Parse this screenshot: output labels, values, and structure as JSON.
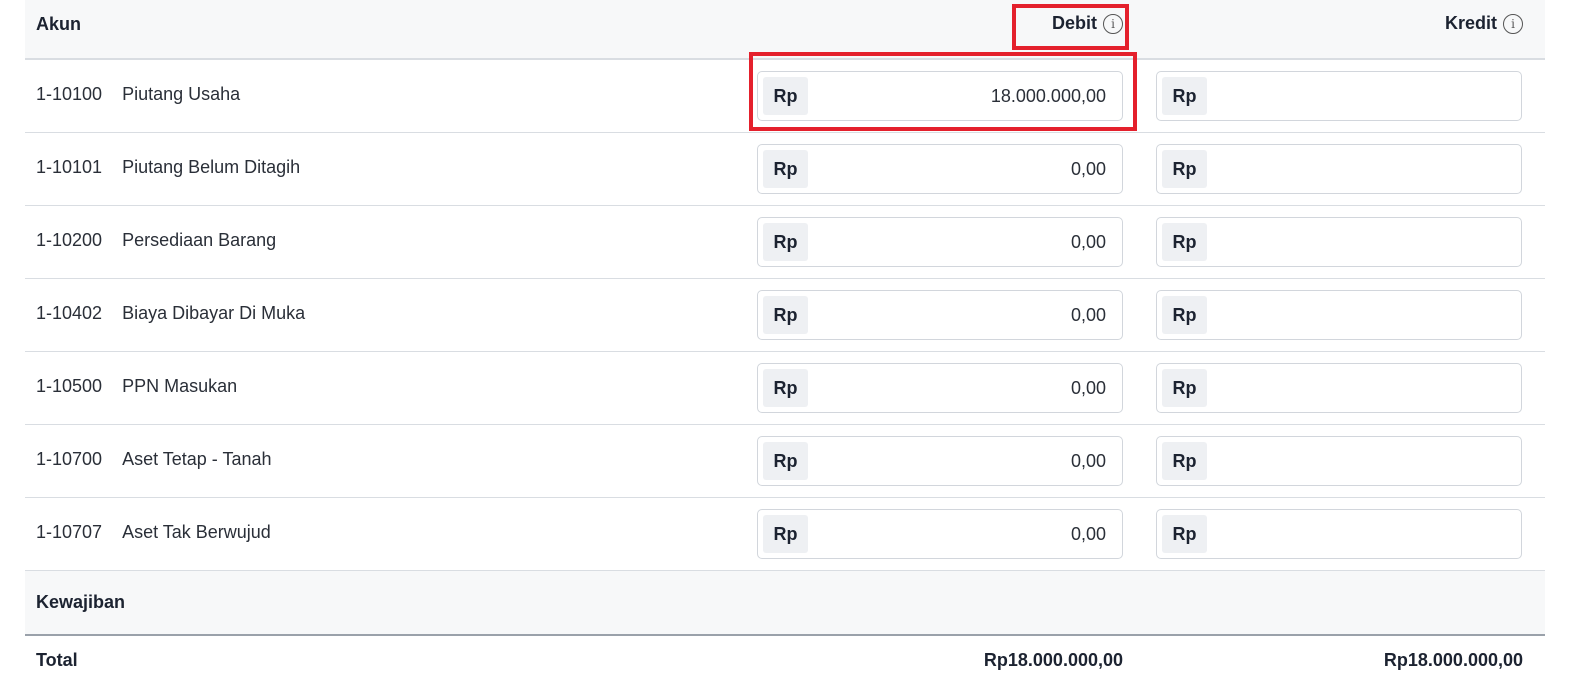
{
  "header": {
    "akun": "Akun",
    "debit": "Debit",
    "kredit": "Kredit",
    "info_glyph": "i"
  },
  "currency_prefix": "Rp",
  "rows": [
    {
      "code": "1-10100",
      "name": "Piutang Usaha",
      "debit": "18.000.000,00",
      "kredit": ""
    },
    {
      "code": "1-10101",
      "name": "Piutang Belum Ditagih",
      "debit": "0,00",
      "kredit": ""
    },
    {
      "code": "1-10200",
      "name": "Persediaan Barang",
      "debit": "0,00",
      "kredit": ""
    },
    {
      "code": "1-10402",
      "name": "Biaya Dibayar Di Muka",
      "debit": "0,00",
      "kredit": ""
    },
    {
      "code": "1-10500",
      "name": "PPN Masukan",
      "debit": "0,00",
      "kredit": ""
    },
    {
      "code": "1-10700",
      "name": "Aset Tetap - Tanah",
      "debit": "0,00",
      "kredit": ""
    },
    {
      "code": "1-10707",
      "name": "Aset Tak Berwujud",
      "debit": "0,00",
      "kredit": ""
    }
  ],
  "section_kewajiban": "Kewajiban",
  "total": {
    "label": "Total",
    "debit": "Rp18.000.000,00",
    "kredit": "Rp18.000.000,00"
  },
  "colors": {
    "highlight": "#e4202c",
    "header_bg": "#f7f8f9"
  }
}
